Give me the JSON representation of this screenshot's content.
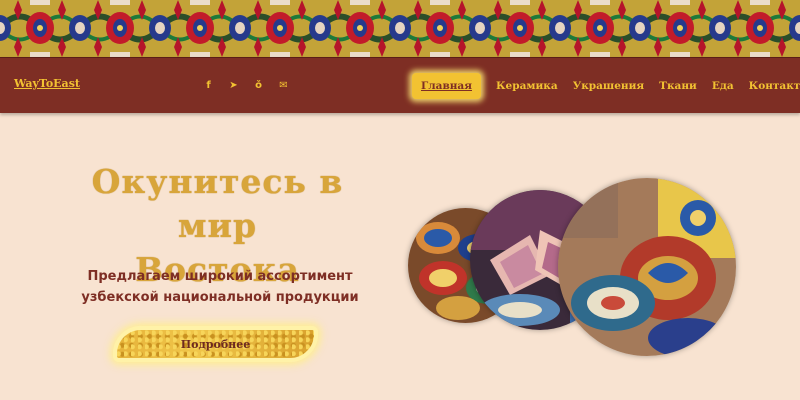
{
  "header": {
    "logo": "WayToEast",
    "socials": [
      {
        "icon": "facebook-icon",
        "glyph": "f"
      },
      {
        "icon": "telegram-icon",
        "glyph": "➤"
      },
      {
        "icon": "odnoklassniki-icon",
        "glyph": "ǒ"
      },
      {
        "icon": "mail-icon",
        "glyph": "✉"
      }
    ],
    "nav": [
      "Главная",
      "Керамика",
      "Украшения",
      "Ткани",
      "Еда",
      "Контакты"
    ],
    "active_nav": "Главная"
  },
  "hero": {
    "title_line1": "Окунитесь в мир",
    "title_line2": "Востока",
    "subtitle_line1": "Предлагаем широкий ассортимент",
    "subtitle_line2": "узбекской национальной продукции",
    "button": "Подробнее"
  },
  "colors": {
    "page_bg": "#f8e3d1",
    "header_bg": "#7e2e24",
    "accent_gold": "#f2c232",
    "title_gold": "#d8a53a",
    "text_brown": "#7e2e24"
  },
  "images": {
    "banner": "uzbek-ikat-pattern",
    "circle1": "painted-bowls",
    "circle2": "ceramic-plates",
    "circle3": "pottery-jug-and-bowl"
  }
}
